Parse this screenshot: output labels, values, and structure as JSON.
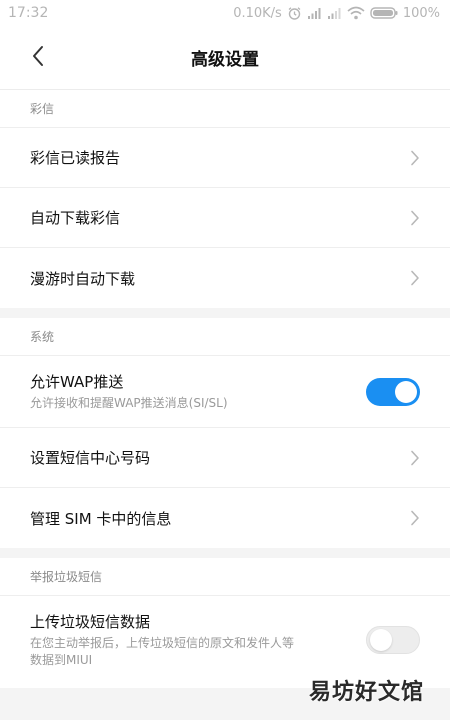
{
  "status_bar": {
    "time": "17:32",
    "speed": "0.10K/s",
    "battery": "100%"
  },
  "header": {
    "title": "高级设置"
  },
  "sections": {
    "mms": {
      "label": "彩信",
      "items": [
        {
          "label": "彩信已读报告"
        },
        {
          "label": "自动下载彩信"
        },
        {
          "label": "漫游时自动下载"
        }
      ]
    },
    "system": {
      "label": "系统",
      "wap": {
        "label": "允许WAP推送",
        "sub": "允许接收和提醒WAP推送消息(SI/SL)",
        "enabled": true
      },
      "items": [
        {
          "label": "设置短信中心号码"
        },
        {
          "label": "管理 SIM 卡中的信息"
        }
      ]
    },
    "spam": {
      "label": "举报垃圾短信",
      "upload": {
        "label": "上传垃圾短信数据",
        "sub": "在您主动举报后，上传垃圾短信的原文和发件人等数据到MIUI",
        "enabled": false
      }
    }
  },
  "watermark": "易坊好文馆",
  "colors": {
    "toggle_on": "#1a8ff2",
    "section_gap": "#f4f4f4"
  },
  "icons": {
    "back": "chevron-left-icon",
    "row": "chevron-right-icon"
  }
}
